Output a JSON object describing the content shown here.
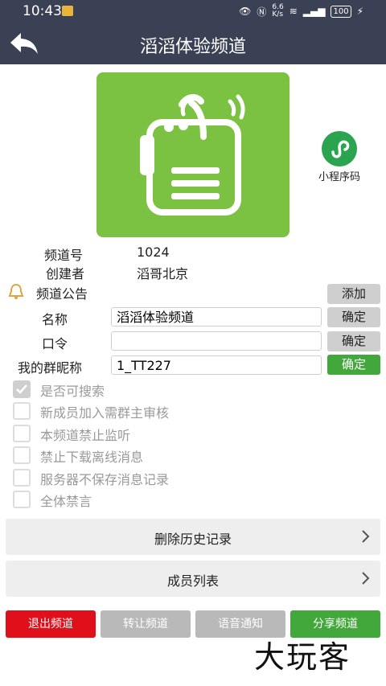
{
  "status": {
    "time": "10:43",
    "net_speed": "6.6\nK/s",
    "battery": "100"
  },
  "header": {
    "title": "滔滔体验频道"
  },
  "mini_program": {
    "label": "小程序码"
  },
  "info": {
    "channel_no_label": "频道号",
    "channel_no_value": "1024",
    "creator_label": "创建者",
    "creator_value": "滔哥北京",
    "notice_label": "频道公告",
    "notice_add": "添加"
  },
  "form": {
    "name_label": "名称",
    "name_value": "滔滔体验频道",
    "name_confirm": "确定",
    "password_label": "口令",
    "password_value": "",
    "password_confirm": "确定",
    "nickname_label": "我的群昵称",
    "nickname_value": "1_TT227",
    "nickname_confirm": "确定"
  },
  "options": [
    {
      "label": "是否可搜索",
      "checked": true
    },
    {
      "label": "新成员加入需群主审核",
      "checked": false
    },
    {
      "label": "本频道禁止监听",
      "checked": false
    },
    {
      "label": "禁止下载离线消息",
      "checked": false
    },
    {
      "label": "服务器不保存消息记录",
      "checked": false
    },
    {
      "label": "全体禁言",
      "checked": false
    }
  ],
  "rows": {
    "clear_history": "删除历史记录",
    "member_list": "成员列表"
  },
  "bottom": {
    "exit": "退出频道",
    "transfer": "转让频道",
    "voice": "语音通知",
    "share": "分享频道"
  },
  "colors": {
    "header": "#3a4155",
    "green": "#43a83b",
    "red": "#e0101a",
    "gray": "#b9b9b9"
  },
  "watermark": "大玩客"
}
